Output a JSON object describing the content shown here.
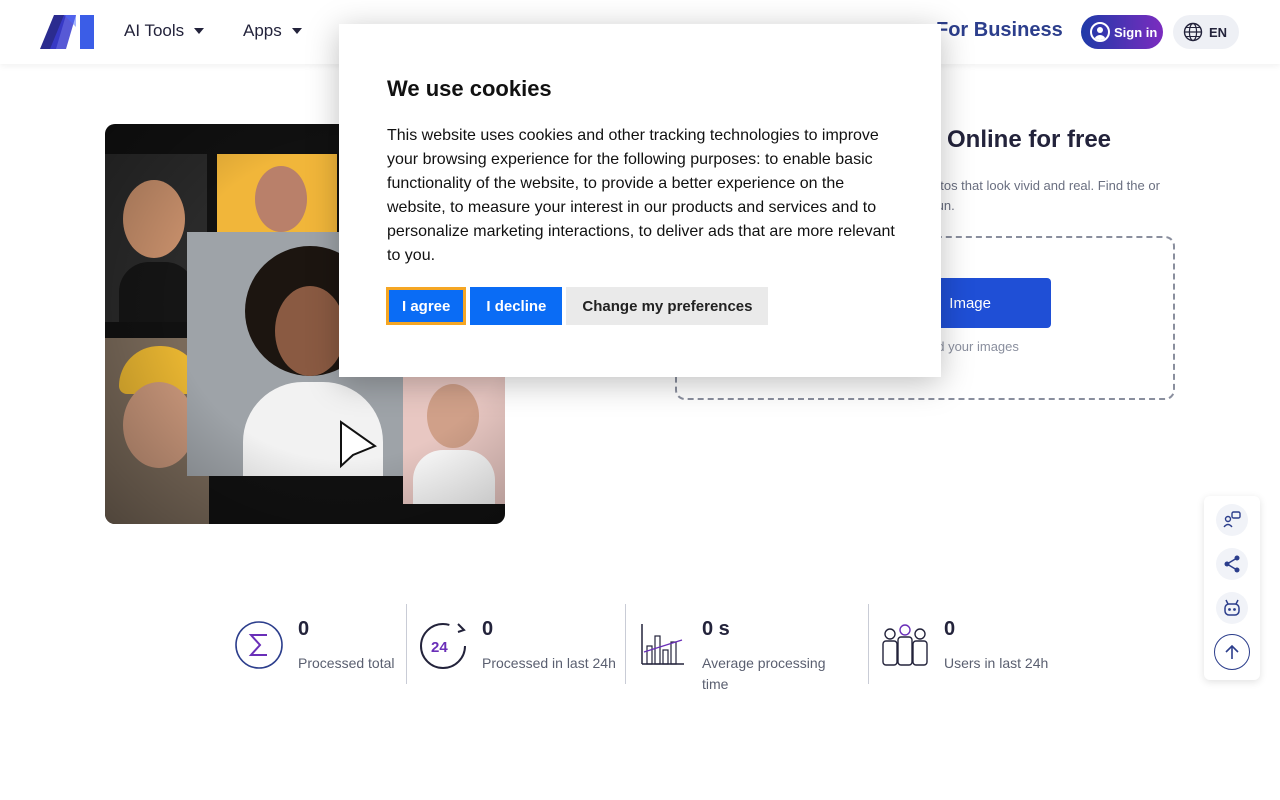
{
  "header": {
    "logo_text": "AI",
    "nav": [
      {
        "label": "AI Tools"
      },
      {
        "label": "Apps"
      }
    ],
    "business_label": "For Business",
    "signin_label": "Sign in",
    "lang_label": "EN"
  },
  "hero": {
    "title_fragment": "Online for free",
    "desc_fragment": "otos that look vivid and real. Find the or fun.",
    "upload_label_fragment": "Image",
    "drop_hint_fragment": "ad your images"
  },
  "stats": [
    {
      "value": "0",
      "label": "Processed total",
      "icon": "sigma-icon"
    },
    {
      "value": "0",
      "label": "Processed in last 24h",
      "icon": "24h-icon"
    },
    {
      "value": "0 s",
      "label": "Average processing time",
      "icon": "bar-chart-icon"
    },
    {
      "value": "0",
      "label": "Users in last 24h",
      "icon": "users-icon"
    }
  ],
  "side_rail": [
    {
      "icon": "feedback-icon"
    },
    {
      "icon": "share-icon"
    },
    {
      "icon": "bot-icon"
    },
    {
      "icon": "scroll-top-icon"
    }
  ],
  "cookie_modal": {
    "title": "We use cookies",
    "body": "This website uses cookies and other tracking technologies to improve your browsing experience for the following purposes: to enable basic functionality of the website, to provide a better experience on the website, to measure your interest in our products and services and to personalize marketing interactions, to deliver ads that are more relevant to you.",
    "agree_label": "I agree",
    "decline_label": "I decline",
    "prefs_label": "Change my preferences"
  },
  "colors": {
    "brand_blue": "#1f4fd6",
    "accent_button": "#0a6cf5",
    "focus_outline": "#f5a623"
  }
}
